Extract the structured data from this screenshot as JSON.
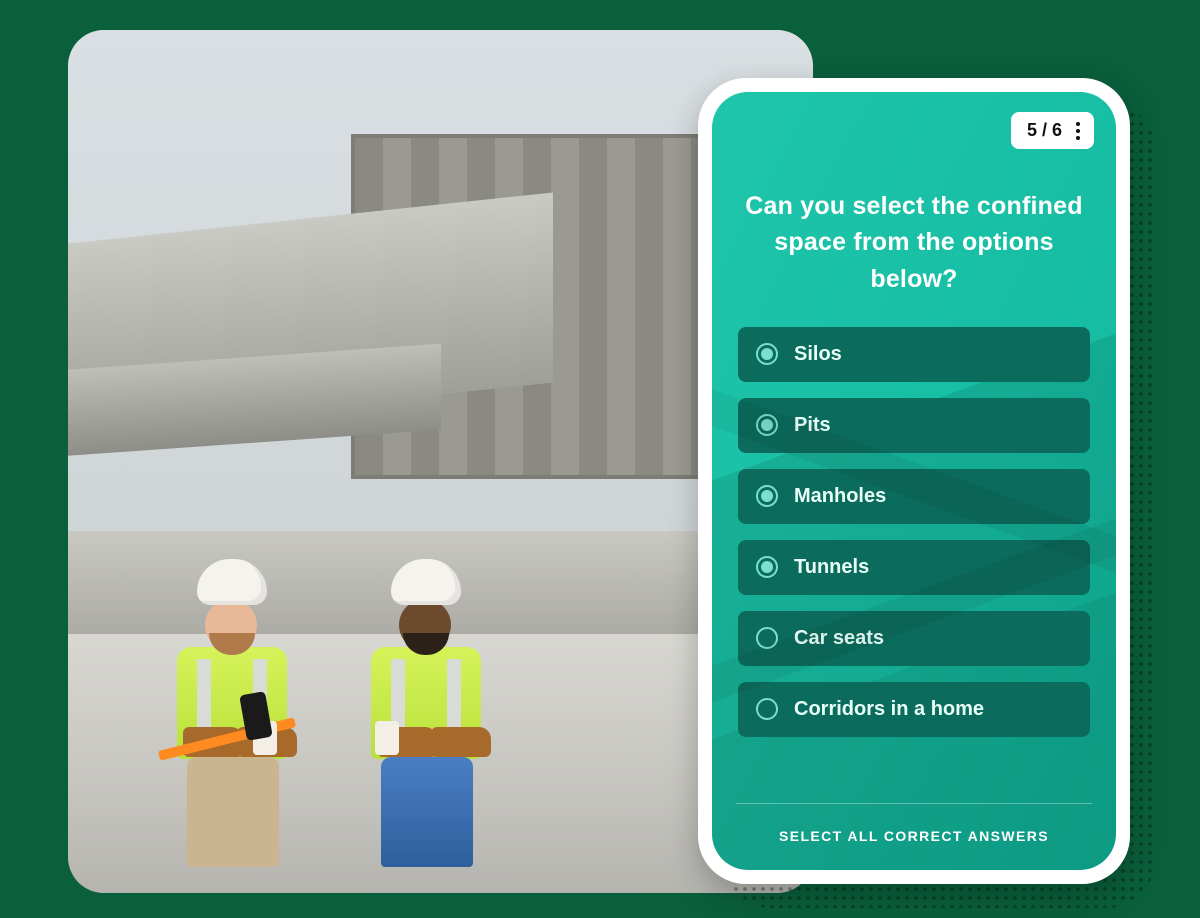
{
  "photo": {
    "alt": "Two construction workers in hi-vis vests and white hard hats sitting at a building site looking at a smartphone"
  },
  "quiz": {
    "progress": {
      "current": 5,
      "total": 6,
      "label": "5 / 6"
    },
    "question": "Can you select the confined space from the options below?",
    "options": [
      {
        "label": "Silos",
        "selected": true
      },
      {
        "label": "Pits",
        "selected": true
      },
      {
        "label": "Manholes",
        "selected": true
      },
      {
        "label": "Tunnels",
        "selected": true
      },
      {
        "label": "Car seats",
        "selected": false
      },
      {
        "label": "Corridors in a home",
        "selected": false
      }
    ],
    "hint": "SELECT ALL CORRECT ANSWERS"
  },
  "colors": {
    "page_bg": "#0a5f3c",
    "phone_bg": "#0fb39a",
    "option_bg": "#0b6b5c",
    "accent": "#7adfce"
  }
}
